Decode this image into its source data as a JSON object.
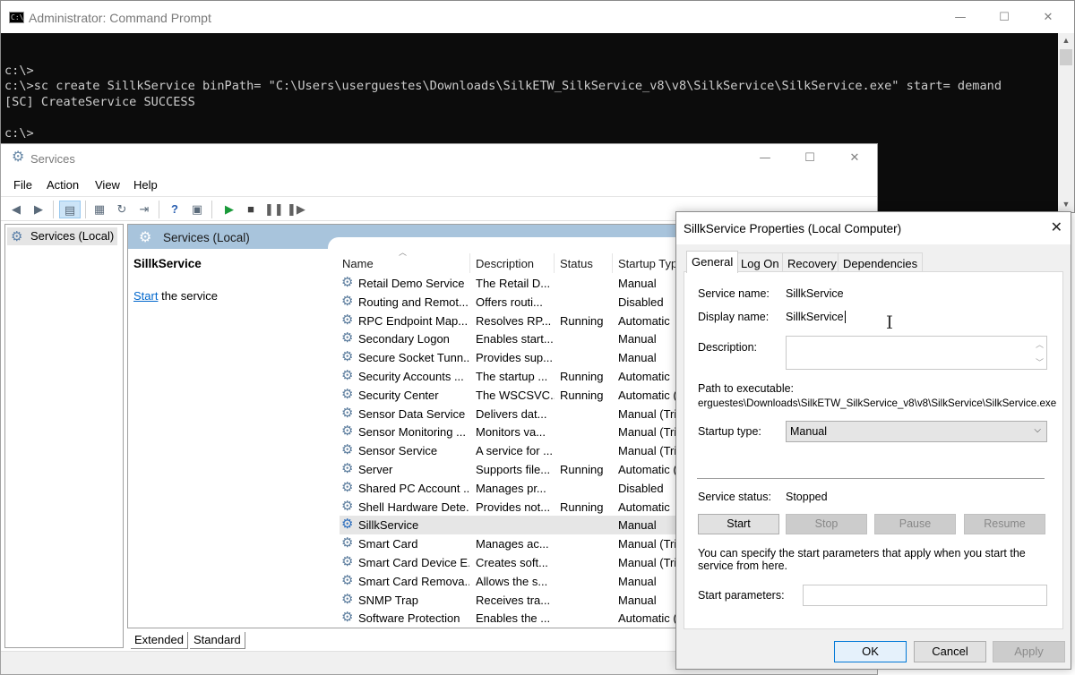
{
  "cmd": {
    "title": "Administrator: Command Prompt",
    "icon_label": "C:\\",
    "lines": [
      "",
      "c:\\>",
      "c:\\>sc create SillkService binPath= \"C:\\Users\\userguestes\\Downloads\\SilkETW_SilkService_v8\\v8\\SilkService\\SilkService.exe\" start= demand",
      "[SC] CreateService SUCCESS",
      "",
      "c:\\>"
    ]
  },
  "services": {
    "title": "Services",
    "menu": [
      "File",
      "Action",
      "View",
      "Help"
    ],
    "tree_root": "Services (Local)",
    "header_title": "Services (Local)",
    "selected_name": "SillkService",
    "start_link": "Start",
    "start_suffix": " the service",
    "columns": [
      "Name",
      "Description",
      "Status",
      "Startup Typ"
    ],
    "rows": [
      {
        "name": "Retail Demo Service",
        "desc": "The Retail D...",
        "status": "",
        "type": "Manual"
      },
      {
        "name": "Routing and Remot...",
        "desc": "Offers routi...",
        "status": "",
        "type": "Disabled"
      },
      {
        "name": "RPC Endpoint Map...",
        "desc": "Resolves RP...",
        "status": "Running",
        "type": "Automatic"
      },
      {
        "name": "Secondary Logon",
        "desc": "Enables start...",
        "status": "",
        "type": "Manual"
      },
      {
        "name": "Secure Socket Tunn...",
        "desc": "Provides sup...",
        "status": "",
        "type": "Manual"
      },
      {
        "name": "Security Accounts ...",
        "desc": "The startup ...",
        "status": "Running",
        "type": "Automatic"
      },
      {
        "name": "Security Center",
        "desc": "The WSCSVC...",
        "status": "Running",
        "type": "Automatic ("
      },
      {
        "name": "Sensor Data Service",
        "desc": "Delivers dat...",
        "status": "",
        "type": "Manual (Trig"
      },
      {
        "name": "Sensor Monitoring ...",
        "desc": "Monitors va...",
        "status": "",
        "type": "Manual (Trig"
      },
      {
        "name": "Sensor Service",
        "desc": "A service for ...",
        "status": "",
        "type": "Manual (Trig"
      },
      {
        "name": "Server",
        "desc": "Supports file...",
        "status": "Running",
        "type": "Automatic ("
      },
      {
        "name": "Shared PC Account ...",
        "desc": "Manages pr...",
        "status": "",
        "type": "Disabled"
      },
      {
        "name": "Shell Hardware Dete...",
        "desc": "Provides not...",
        "status": "Running",
        "type": "Automatic"
      },
      {
        "name": "SillkService",
        "desc": "",
        "status": "",
        "type": "Manual"
      },
      {
        "name": "Smart Card",
        "desc": "Manages ac...",
        "status": "",
        "type": "Manual (Trig"
      },
      {
        "name": "Smart Card Device E...",
        "desc": "Creates soft...",
        "status": "",
        "type": "Manual (Trig"
      },
      {
        "name": "Smart Card Remova...",
        "desc": "Allows the s...",
        "status": "",
        "type": "Manual"
      },
      {
        "name": "SNMP Trap",
        "desc": "Receives tra...",
        "status": "",
        "type": "Manual"
      },
      {
        "name": "Software Protection",
        "desc": "Enables the ...",
        "status": "",
        "type": "Automatic ("
      }
    ],
    "bottom_tabs": [
      "Extended",
      "Standard"
    ]
  },
  "dialog": {
    "title": "SillkService Properties (Local Computer)",
    "tabs": [
      "General",
      "Log On",
      "Recovery",
      "Dependencies"
    ],
    "service_name_label": "Service name:",
    "service_name": "SillkService",
    "display_name_label": "Display name:",
    "display_name": "SillkService",
    "description_label": "Description:",
    "path_label": "Path to executable:",
    "path": "erguestes\\Downloads\\SilkETW_SilkService_v8\\v8\\SilkService\\SilkService.exe",
    "startup_type_label": "Startup type:",
    "startup_type": "Manual",
    "service_status_label": "Service status:",
    "service_status": "Stopped",
    "buttons": {
      "start": "Start",
      "stop": "Stop",
      "pause": "Pause",
      "resume": "Resume"
    },
    "note": "You can specify the start parameters that apply when you start the service from here.",
    "start_params_label": "Start parameters:",
    "ok": "OK",
    "cancel": "Cancel",
    "apply": "Apply"
  }
}
